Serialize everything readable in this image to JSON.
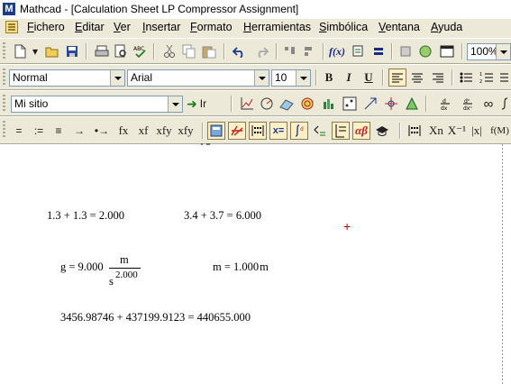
{
  "window": {
    "title": "Mathcad - [Calculation Sheet LP Compressor Assignment]",
    "app_icon_letter": "M"
  },
  "menu": [
    "Fichero",
    "Editar",
    "Ver",
    "Insertar",
    "Formato",
    "Herramientas",
    "Simbólica",
    "Ventana",
    "Ayuda"
  ],
  "standard_toolbar": {
    "zoom": "100%"
  },
  "format_toolbar": {
    "style": "Normal",
    "font": "Arial",
    "size": "10",
    "bold": "B",
    "italic": "I",
    "underline": "U"
  },
  "resources_toolbar": {
    "site": "Mi sitio",
    "go_label": "Ir"
  },
  "math_toolbar": {
    "eval_symbols": [
      "=",
      ":=",
      "≡",
      "→",
      "•→",
      "fx",
      "xf",
      "xfy",
      "xfy"
    ],
    "palette_labels": [
      "x=",
      "αβ"
    ],
    "vector_labels": [
      "Xn",
      "X⁻¹",
      "|x|",
      "f(M)"
    ]
  },
  "worksheet": {
    "expr1": "1.3 + 1.3 = 2.000",
    "expr2": "3.4 + 3.7 = 6.000",
    "g_lhs": "g = 9.000",
    "g_num": "m",
    "g_den_base": "s",
    "g_den_exp": "2.000",
    "m_expr": "m = 1.000",
    "m_unit": "m",
    "expr3": "3456.98746 + 437199.9123 = 440655.000",
    "cursor_symbol": "+"
  },
  "colors": {
    "chrome": "#ece9d8",
    "canvas": "#ffffff",
    "cursor": "#c00000"
  }
}
